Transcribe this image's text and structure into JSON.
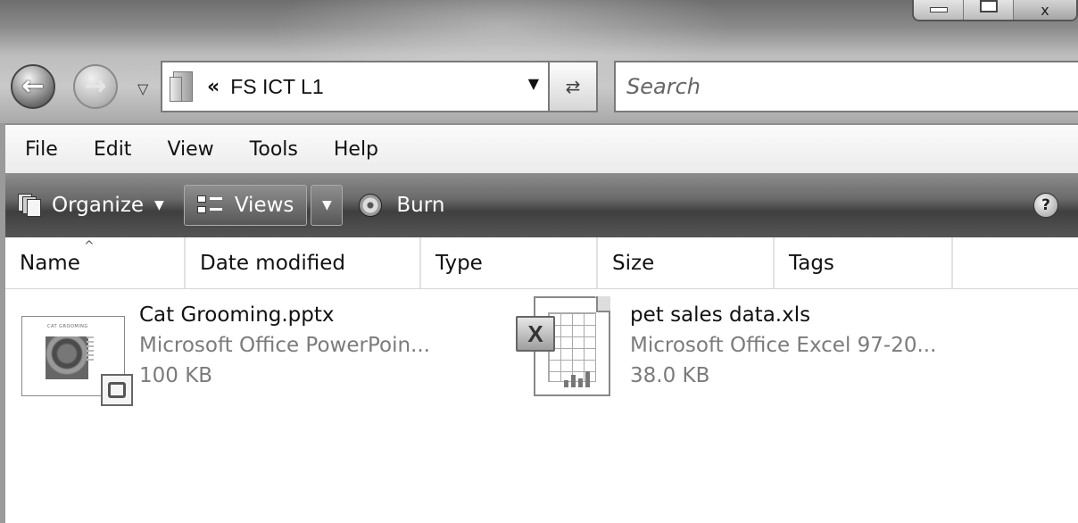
{
  "window": {
    "controls": {
      "close_glyph": "x"
    }
  },
  "address_bar": {
    "chevron": "«",
    "path": "FS ICT L1"
  },
  "search": {
    "placeholder": "Search"
  },
  "menu": [
    "File",
    "Edit",
    "View",
    "Tools",
    "Help"
  ],
  "command_bar": {
    "organize_label": "Organize",
    "views_label": "Views",
    "burn_label": "Burn",
    "help_glyph": "?"
  },
  "columns": [
    "Name",
    "Date modified",
    "Type",
    "Size",
    "Tags"
  ],
  "files": [
    {
      "name": "Cat Grooming.pptx",
      "type": "Microsoft Office PowerPoin...",
      "size": "100 KB",
      "icon": "powerpoint-thumbnail-icon",
      "thumbnail_title": "CAT GROOMING"
    },
    {
      "name": "pet sales data.xls",
      "type": "Microsoft Office Excel 97-20...",
      "size": "38.0 KB",
      "icon": "excel-file-icon"
    }
  ],
  "colors": {
    "command_bar": "#4a4a4a",
    "file_meta_text": "#7b7b7b"
  }
}
